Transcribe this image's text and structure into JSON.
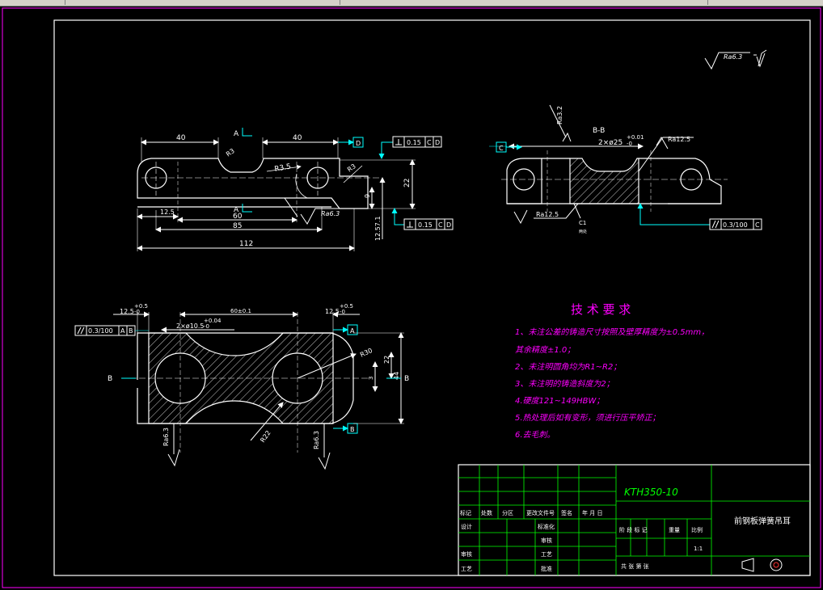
{
  "title_block": {
    "part_number": "KTH350-10",
    "part_name": "前钢板弹簧吊耳",
    "row_labels": [
      "标记",
      "处数",
      "分区",
      "更改文件号",
      "签名",
      "年 月 日"
    ],
    "design": "设计",
    "standardize": "标准化",
    "review": "审核",
    "craft": "工艺",
    "approve": "批准",
    "check": "审核",
    "stage_mark": "阶 段 标 记",
    "weight": "重量",
    "scale": "比例",
    "scale_value": "1:1",
    "sheets": "共   张   第   张"
  },
  "roughness_global": "Ra6.3",
  "tech_requirements": {
    "heading": "技 术 要 求",
    "items": [
      "1、未注公差的铸造尺寸按照及壁厚精度为±0.5mm，",
      "其余精度±1.0；",
      "2、未注明圆角均为R1~R2；",
      "3、未注明的铸造斜度为2；",
      "4.硬度121~149HBW；",
      "5.热处理后如有变形，须进行压平矫正；",
      "6.去毛刺。"
    ]
  },
  "front_view": {
    "dims": [
      "40",
      "40",
      "R3",
      "R3.5",
      "R3",
      "12.5",
      "60",
      "85",
      "112",
      "9",
      "22",
      "12.57.1"
    ],
    "section_a": "A",
    "datum_d": "D",
    "tol_top": "0.15",
    "tol_top_refs": [
      "C",
      "D"
    ],
    "tol_bottom": "0.15",
    "tol_bottom_refs": [
      "C",
      "D"
    ],
    "roughness": "Ra6.3"
  },
  "side_view": {
    "label": "B-B",
    "bore": "2×ø25",
    "bore_tol_upper": "+0.01",
    "bore_tol_lower": "-0",
    "roughness_top": "Ra3.2",
    "roughness_right": "Ra12.5",
    "roughness_bottom": "Ra12.5",
    "chamfer": "C1",
    "chamfer_note": "两处",
    "datum_c": "C",
    "tol_parallel": "0.3/100",
    "tol_parallel_ref": "C"
  },
  "top_view": {
    "dim_left": "12.5",
    "dim_right": "12.5",
    "tol_plus": "+0.5",
    "tol_minus": "-0",
    "center": "60±0.1",
    "holes": "2×ø10.5",
    "holes_tol_upper": "+0.04",
    "holes_tol_lower": "-0",
    "tol_parallel": "0.3/100",
    "tol_refs": [
      "A",
      "B"
    ],
    "datum_a": "A",
    "datum_b": "B",
    "r30": "R30",
    "r22": "R22",
    "d22": "22",
    "d44": "44",
    "d3": "3",
    "section_b": "B",
    "roughness_left": "Ra6.3",
    "roughness_right": "Ra6.3"
  }
}
